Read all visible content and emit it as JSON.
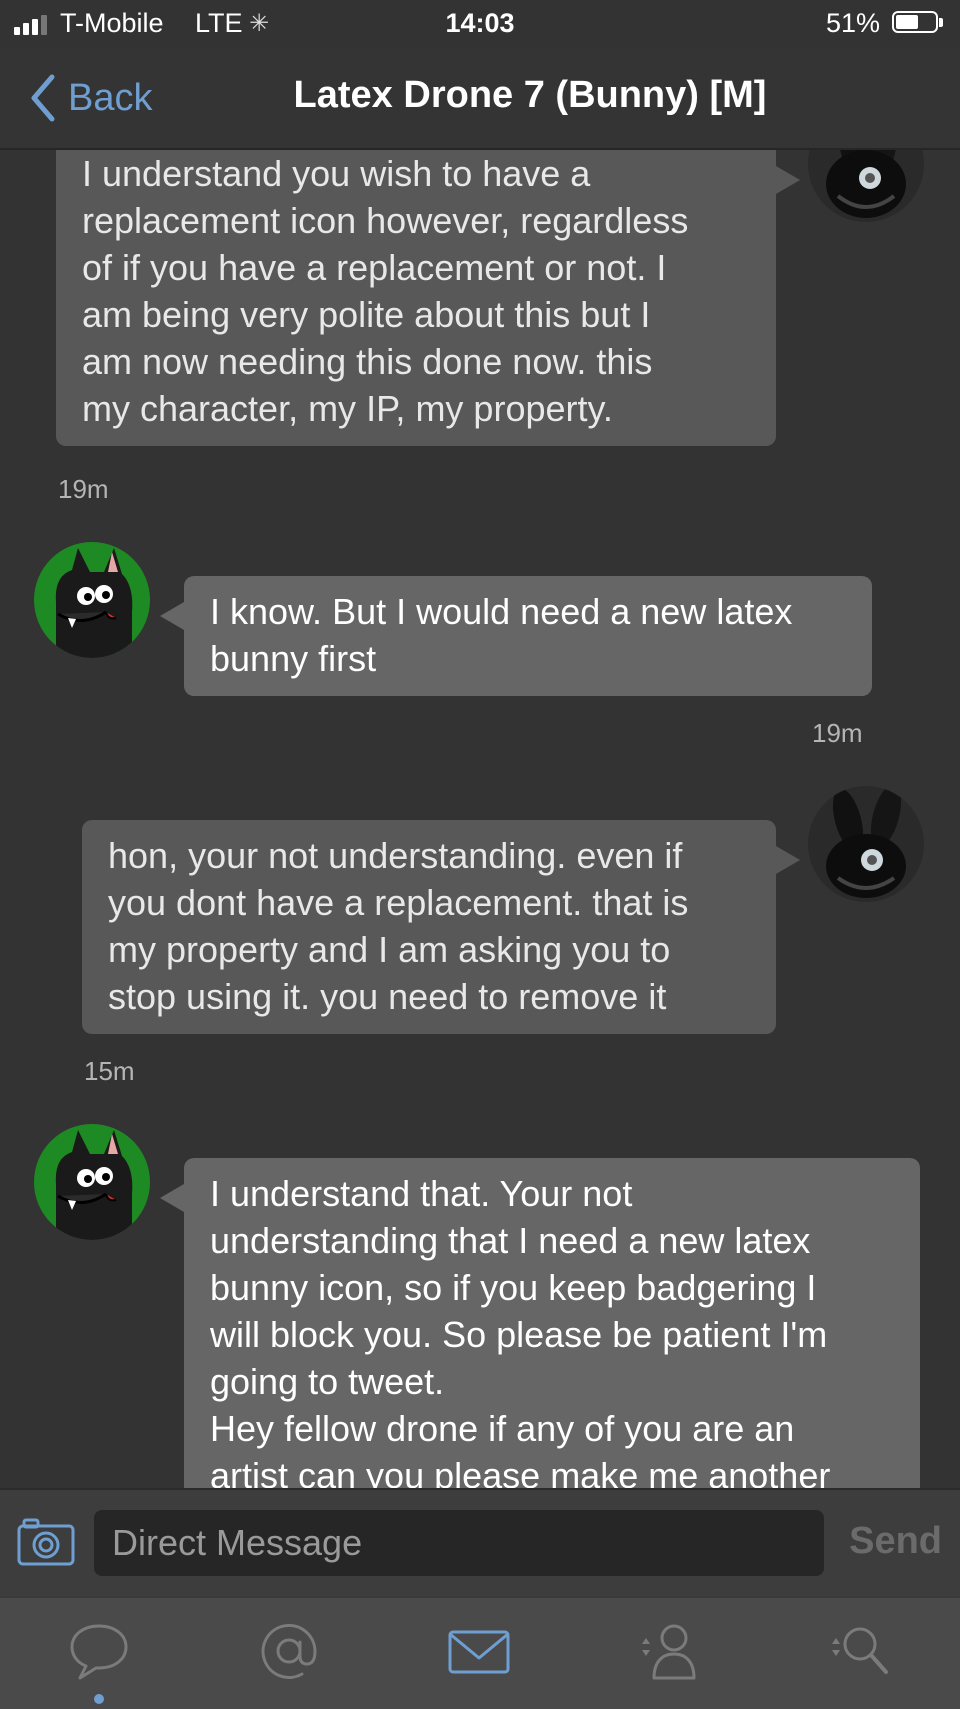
{
  "status_bar": {
    "carrier": "T-Mobile",
    "network": "LTE",
    "time": "14:03",
    "battery_percent": "51%",
    "battery_level": 0.51
  },
  "nav": {
    "back_label": "Back",
    "title": "Latex Drone 7 (Bunny) [M]"
  },
  "messages": [
    {
      "side": "right",
      "lines": [
        "I understand you wish to have a",
        "replacement icon however, regardless",
        "of if you have a replacement or not. I",
        "am being very polite about this but I",
        "am now needing this done now. this",
        "my character, my IP, my property."
      ],
      "time": "19m"
    },
    {
      "side": "left",
      "lines": [
        "I know. But I would need a new latex",
        "bunny first"
      ],
      "time": "19m"
    },
    {
      "side": "right",
      "lines": [
        "hon, your not understanding. even if",
        "you dont have a replacement. that is",
        "my property and I am asking you to",
        "stop using it. you need to remove it"
      ],
      "time": "15m"
    },
    {
      "side": "left",
      "lines": [
        "I understand that. Your not",
        "understanding that I need a new latex",
        "bunny icon, so if you keep badgering I",
        "will block you. So please be patient I'm",
        "going to tweet.",
        "Hey fellow drone if any of you are an",
        "artist can you please make me another"
      ]
    }
  ],
  "composer": {
    "placeholder": "Direct Message",
    "send_label": "Send"
  },
  "tabs": [
    {
      "name": "messages",
      "icon": "speech-bubble-icon",
      "active": true
    },
    {
      "name": "mentions",
      "icon": "at-sign-icon"
    },
    {
      "name": "direct-messages",
      "icon": "envelope-icon"
    },
    {
      "name": "profile",
      "icon": "person-icon"
    },
    {
      "name": "search",
      "icon": "magnifier-icon"
    }
  ],
  "colors": {
    "accent": "#6f9fd1",
    "background": "#333333",
    "own_bubble": "#585858",
    "their_bubble": "#666666"
  }
}
